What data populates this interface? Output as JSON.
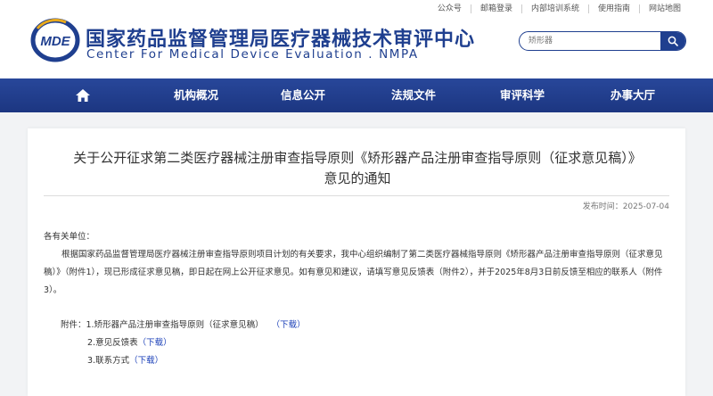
{
  "toplinks": [
    "公众号",
    "邮箱登录",
    "内部培训系统",
    "使用指南",
    "网站地图"
  ],
  "site": {
    "logo_text": "MDE",
    "name_cn": "国家药品监督管理局医疗器械技术审评中心",
    "name_en": "Center For Medical Device Evaluation . NMPA"
  },
  "search": {
    "placeholder": "矫形器",
    "icon": "search-icon"
  },
  "nav": {
    "home_icon": "home-icon",
    "items": [
      "机构概况",
      "信息公开",
      "法规文件",
      "审评科学",
      "办事大厅"
    ]
  },
  "article": {
    "title_line1": "关于公开征求第二类医疗器械注册审查指导原则《矫形器产品注册审查指导原则（征求意见稿）》",
    "title_line2": "意见的通知",
    "date": "发布时间：2025-07-04",
    "salutation": "各有关单位：",
    "paragraph": "根据国家药品监督管理局医疗器械注册审查指导原则项目计划的有关要求，我中心组织编制了第二类医疗器械指导原则《矫形器产品注册审查指导原则（征求意见稿）》（附件1），现已形成征求意见稿，即日起在网上公开征求意见。如有意见和建议，请填写意见反馈表（附件2），并于2025年8月3日前反馈至相应的联系人（附件3）。",
    "attachments_label": "附件：",
    "attachments": [
      {
        "name": "1.矫形器产品注册审查指导原则（征求意见稿）",
        "link": "（下载）"
      },
      {
        "name": "2.意见反馈表",
        "link": "（下载）"
      },
      {
        "name": "3.联系方式",
        "link": "（下载）"
      }
    ]
  },
  "colors": {
    "brand": "#1f3f8f",
    "nav": "#243f92",
    "link": "#1a3fb8"
  }
}
